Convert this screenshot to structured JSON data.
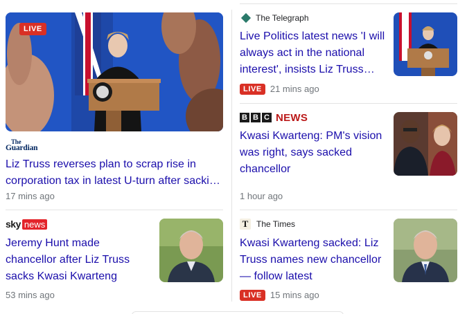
{
  "stories": {
    "guardian": {
      "source_the": "The",
      "source": "Guardian",
      "headline": "Liz Truss reverses plan to scrap rise in corporation tax in latest U-turn after sacki…",
      "time": "17 mins ago",
      "badge": "LIVE"
    },
    "telegraph": {
      "source": "The Telegraph",
      "headline": "Live Politics latest news 'I will always act in the national interest', insists Liz Truss…",
      "time": "21 mins ago",
      "badge": "LIVE"
    },
    "bbc": {
      "logo_letters": [
        "B",
        "B",
        "C"
      ],
      "source": "NEWS",
      "headline": "Kwasi Kwarteng: PM's vision was right, says sacked chancellor",
      "time": "1 hour ago"
    },
    "sky": {
      "source_sky": "sky",
      "source_news": "news",
      "headline": "Jeremy Hunt made chancellor after Liz Truss sacks Kwasi Kwarteng",
      "time": "53 mins ago"
    },
    "times": {
      "icon_letter": "T",
      "source": "The Times",
      "headline": "Kwasi Kwarteng sacked: Liz Truss names new chancellor — follow latest",
      "time": "15 mins ago",
      "badge": "LIVE"
    }
  },
  "colors": {
    "headline": "#1a0dab",
    "live_badge": "#d93025",
    "meta": "#70757a",
    "divider": "#e3e3e3"
  }
}
